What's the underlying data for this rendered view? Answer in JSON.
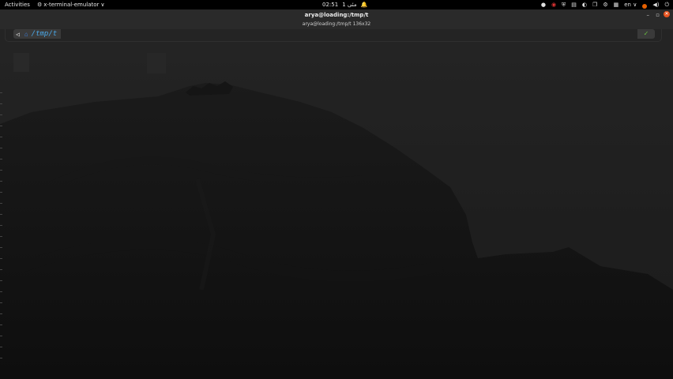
{
  "topbar": {
    "activities": "Activities",
    "app_menu": "x-terminal-emulator",
    "app_menu_arrow": "∨",
    "clock_time": "02:51",
    "clock_date": "1 مئی",
    "bell_icon": "🔔",
    "lang": "en",
    "lang_arrow": "∨"
  },
  "window": {
    "title": "arya@loading:/tmp/t",
    "subtitle": "arya@loading:/tmp/t 136x32",
    "minimize": "–",
    "maximize": "▫",
    "close": "✕"
  },
  "prompt": {
    "distro_icon": "◁",
    "home_icon": "⌂",
    "path": "/tmp/t",
    "status_icon": "✓"
  },
  "colors": {
    "path_blue": "#4aa8e8",
    "status_green": "#6abf40",
    "close_orange": "#e95420"
  }
}
